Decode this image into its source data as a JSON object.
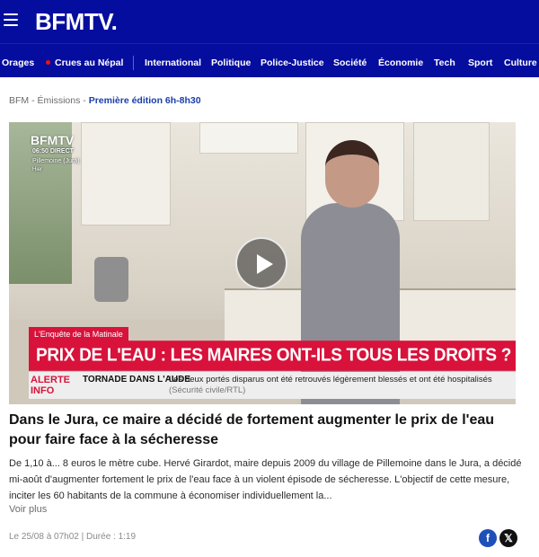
{
  "header": {
    "brand": "BFMTV.",
    "colors": {
      "header_bg": "#050d9e",
      "accent_red": "#d8123b",
      "link_blue": "#1a3ea8"
    }
  },
  "nav": {
    "items": [
      {
        "label": "Orages"
      },
      {
        "label": "Crues au Népal",
        "live": true
      },
      {
        "label": "International"
      },
      {
        "label": "Politique"
      },
      {
        "label": "Police-Justice"
      },
      {
        "label": "Société"
      },
      {
        "label": "Économie"
      },
      {
        "label": "Tech"
      },
      {
        "label": "Sport"
      },
      {
        "label": "Culture"
      }
    ]
  },
  "breadcrumb": {
    "items": [
      "BFM",
      "Émissions",
      "Première édition 6h-8h30"
    ],
    "separator": " - "
  },
  "video": {
    "overlay": {
      "channel": "BFMTV",
      "time": "06:50",
      "live": "DIRECT",
      "place": "Pillemoine (Jura)",
      "date": "Hier"
    },
    "segment_tag": "L'Enquête de la Matinale",
    "headline": "PRIX DE L'EAU : LES MAIRES ONT-ILS TOUS LES DROITS ?",
    "ticker": {
      "label_line1": "ALERTE",
      "label_line2": "INFO",
      "title": "TORNADE DANS L'AUDE",
      "body": "Les deux portés disparus ont été retrouvés légèrement blessés et ont été hospitalisés",
      "source": "(Sécurité civile/RTL)"
    }
  },
  "article": {
    "title": "Dans le Jura, ce maire a décidé de fortement augmenter le prix de l'eau pour faire face à la sécheresse",
    "summary": "De 1,10 à... 8 euros le mètre cube. Hervé Girardot, maire depuis 2009 du village de Pillemoine dans le Jura, a décidé mi-août d'augmenter fortement le prix de l'eau face à un violent épisode de sécheresse. L'objectif de cette mesure, inciter les 60 habitants de la commune à économiser individuellement la...",
    "more_label": "Voir plus",
    "published": "Le 25/08 à 07h02",
    "meta_separator": " | ",
    "duration": "Durée : 1:19"
  },
  "share": {
    "facebook_glyph": "f",
    "x_glyph": "𝕏"
  }
}
